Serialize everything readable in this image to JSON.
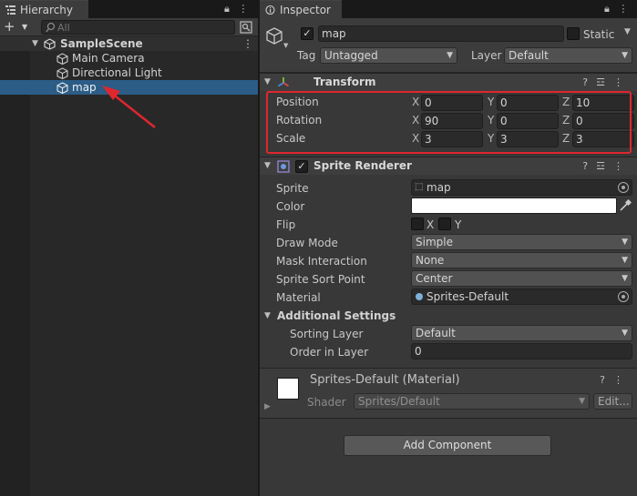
{
  "hierarchy": {
    "tab_label": "Hierarchy",
    "add_button": "+",
    "search_placeholder": "All",
    "scene": "SampleScene",
    "items": [
      {
        "label": "Main Camera"
      },
      {
        "label": "Directional Light"
      },
      {
        "label": "map",
        "selected": true
      }
    ],
    "selection_color": "#2c5d87"
  },
  "inspector": {
    "tab_label": "Inspector",
    "object_name": "map",
    "static_label": "Static",
    "tag_label": "Tag",
    "tag_value": "Untagged",
    "layer_label": "Layer",
    "layer_value": "Default",
    "transform": {
      "title": "Transform",
      "rows": [
        {
          "label": "Position",
          "x": "0",
          "y": "0",
          "z": "10"
        },
        {
          "label": "Rotation",
          "x": "90",
          "y": "0",
          "z": "0"
        },
        {
          "label": "Scale",
          "x": "3",
          "y": "3",
          "z": "3"
        }
      ],
      "axis_x": "X",
      "axis_y": "Y",
      "axis_z": "Z",
      "highlight_color": "#e0262e"
    },
    "sprite_renderer": {
      "title": "Sprite Renderer",
      "sprite_label": "Sprite",
      "sprite_value": "map",
      "color_label": "Color",
      "flip_label": "Flip",
      "flip_x": "X",
      "flip_y": "Y",
      "draw_mode_label": "Draw Mode",
      "draw_mode_value": "Simple",
      "mask_label": "Mask Interaction",
      "mask_value": "None",
      "sort_point_label": "Sprite Sort Point",
      "sort_point_value": "Center",
      "material_label": "Material",
      "material_value": "Sprites-Default",
      "additional_label": "Additional Settings",
      "sorting_layer_label": "Sorting Layer",
      "sorting_layer_value": "Default",
      "order_label": "Order in Layer",
      "order_value": "0"
    },
    "material": {
      "title": "Sprites-Default (Material)",
      "shader_label": "Shader",
      "shader_value": "Sprites/Default",
      "edit_button": "Edit..."
    },
    "add_component": "Add Component"
  }
}
